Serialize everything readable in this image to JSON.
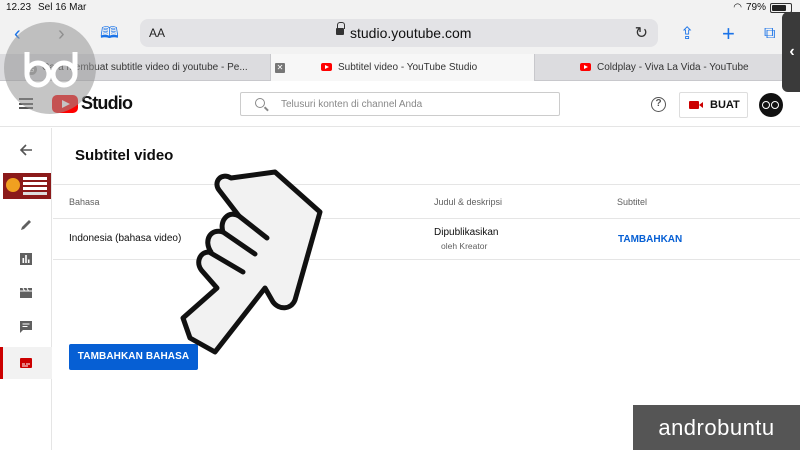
{
  "status_bar": {
    "time": "12.23",
    "date": "Sel 16 Mar",
    "battery_text": "79%",
    "battery_level": 0.79
  },
  "browser": {
    "reader_label": "AA",
    "url": "studio.youtube.com",
    "tabs": [
      {
        "label": "Cara membuat subtitle video di youtube - Pe...",
        "favicon": "google-icon",
        "active": false
      },
      {
        "label": "Subtitel video - YouTube Studio",
        "favicon": "youtube-icon",
        "active": true
      },
      {
        "label": "Coldplay - Viva La Vida - YouTube",
        "favicon": "youtube-icon",
        "active": false
      }
    ]
  },
  "header": {
    "logo_text": "Studio",
    "search_placeholder": "Telusuri konten di channel Anda",
    "create_label": "BUAT"
  },
  "page": {
    "title": "Subtitel video",
    "columns": [
      "Bahasa",
      "Judul & deskripsi",
      "Subtitel"
    ],
    "rows": [
      {
        "language": "Indonesia (bahasa video)",
        "status": "Dipublikasikan",
        "author": "oleh Kreator",
        "action": "TAMBAHKAN"
      }
    ],
    "add_language_label": "TAMBAHKAN BAHASA"
  },
  "watermark": {
    "brand": "androbuntu"
  },
  "colors": {
    "accent": "#065fd4",
    "brand_red": "#ff0000",
    "active_bar": "#cc0000"
  }
}
